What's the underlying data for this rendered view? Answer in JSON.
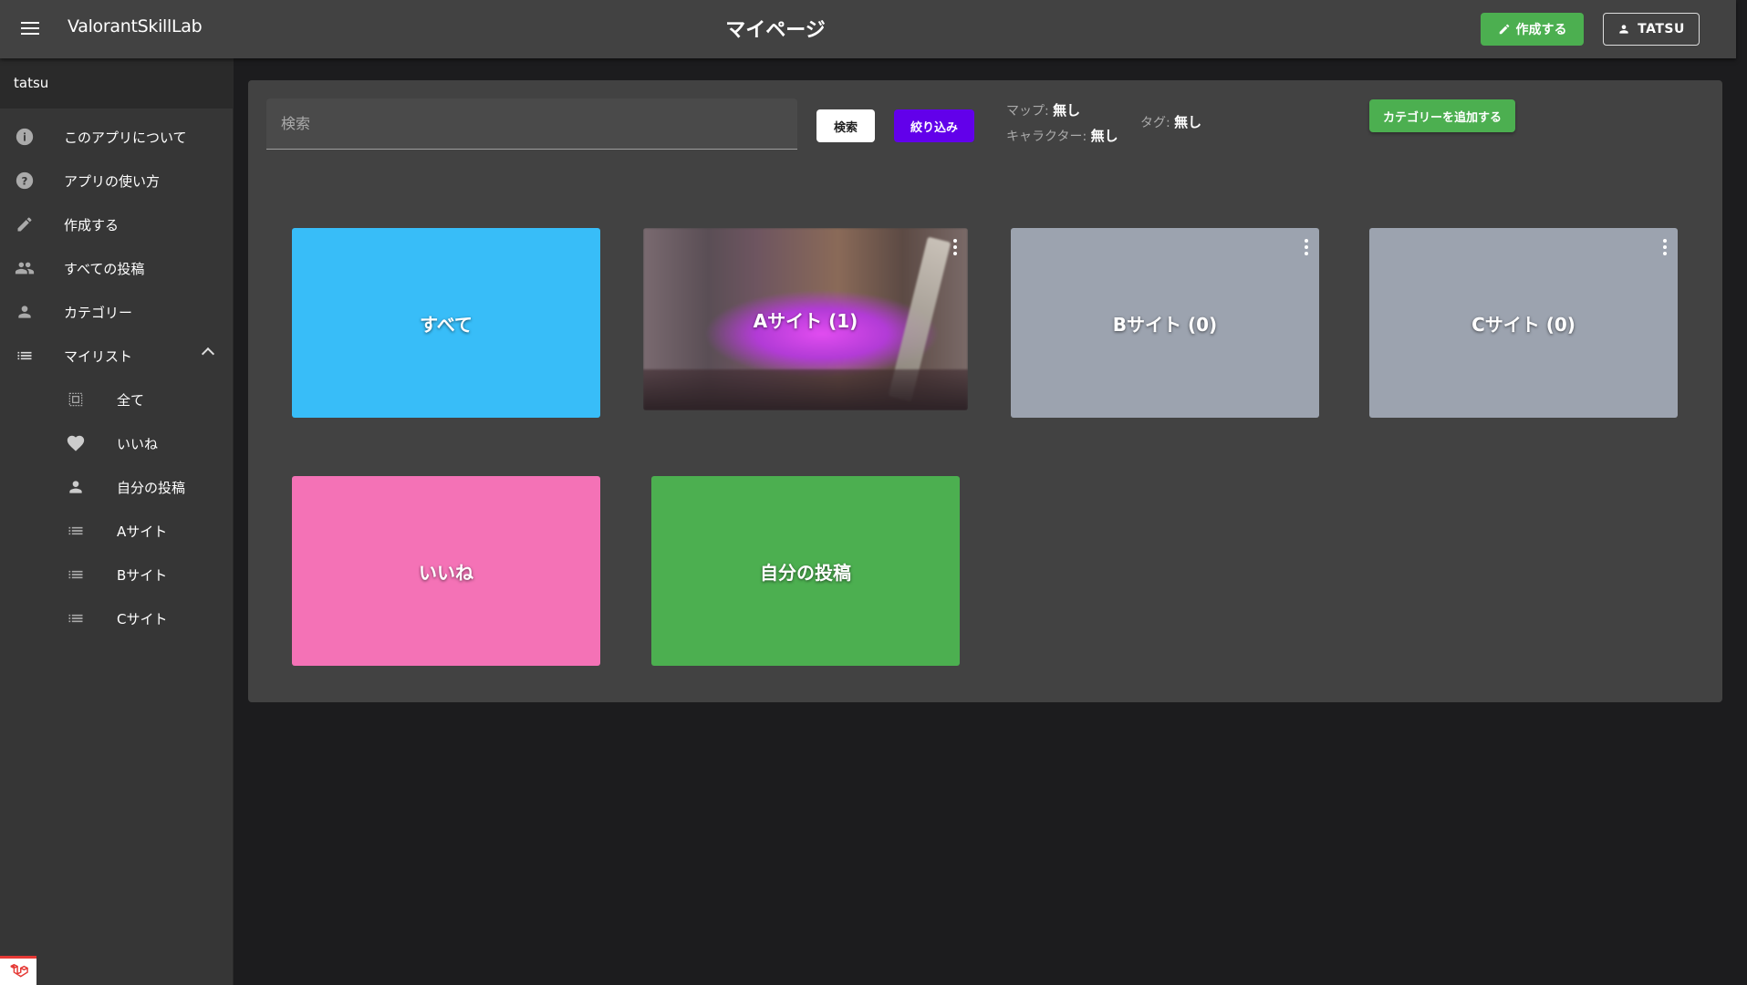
{
  "header": {
    "app_name": "ValorantSkillLab",
    "page_title": "マイページ",
    "create_label": "作成する",
    "user_label": "TATSU"
  },
  "sidebar": {
    "user": "tatsu",
    "items": [
      {
        "label": "このアプリについて",
        "icon": "info-icon"
      },
      {
        "label": "アプリの使い方",
        "icon": "help-icon"
      },
      {
        "label": "作成する",
        "icon": "pencil-icon"
      },
      {
        "label": "すべての投稿",
        "icon": "people-icon"
      },
      {
        "label": "カテゴリー",
        "icon": "person-icon"
      },
      {
        "label": "マイリスト",
        "icon": "list-icon",
        "expanded": true
      }
    ],
    "sub_items": [
      {
        "label": "全て",
        "icon": "view-all-icon"
      },
      {
        "label": "いいね",
        "icon": "heart-icon"
      },
      {
        "label": "自分の投稿",
        "icon": "person-icon"
      },
      {
        "label": "Aサイト",
        "icon": "list-icon"
      },
      {
        "label": "Bサイト",
        "icon": "list-icon"
      },
      {
        "label": "Cサイト",
        "icon": "list-icon"
      }
    ]
  },
  "toolbar": {
    "search_placeholder": "検索",
    "search_label": "検索",
    "filter_label": "絞り込み",
    "map_label": "マップ:",
    "map_value": "無し",
    "character_label": "キャラクター:",
    "character_value": "無し",
    "tag_label": "タグ:",
    "tag_value": "無し",
    "add_category_label": "カテゴリーを追加する"
  },
  "cards": [
    {
      "label": "すべて",
      "color": "#38bdf8"
    },
    {
      "label": "Aサイト (1)",
      "color": "image"
    },
    {
      "label": "Bサイト (0)",
      "color": "#9ca3af"
    },
    {
      "label": "Cサイト (0)",
      "color": "#9ca3af"
    },
    {
      "label": "いいね",
      "color": "#f472b6"
    },
    {
      "label": "自分の投稿",
      "color": "#4caf50"
    }
  ]
}
